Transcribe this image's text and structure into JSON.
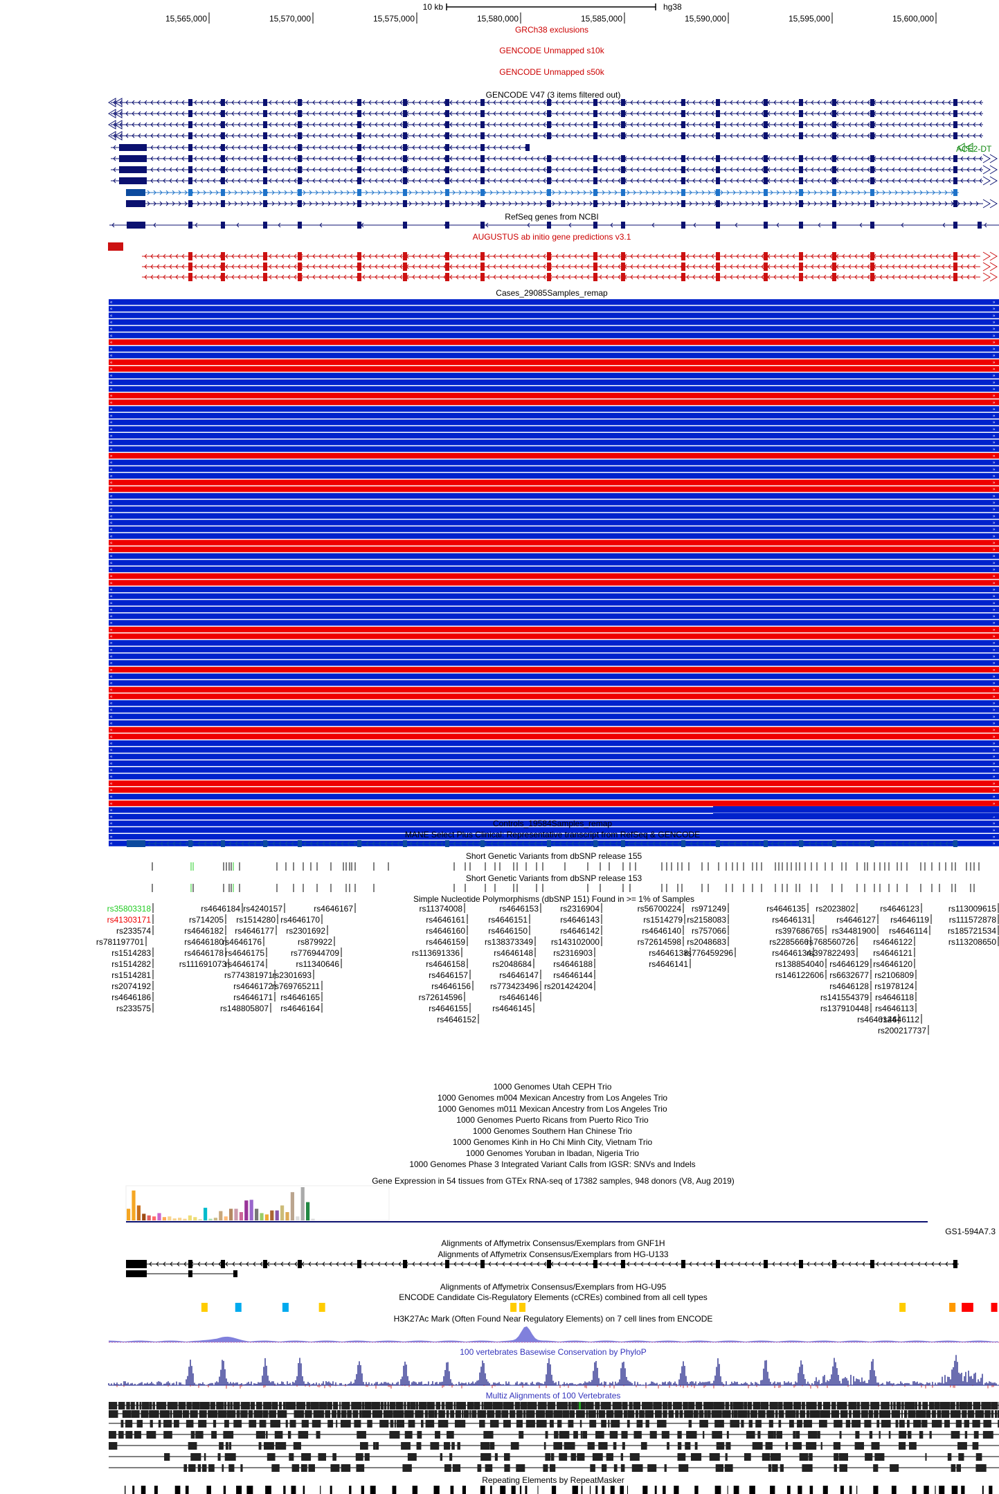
{
  "ruler": {
    "scale_label": "10 kb",
    "assembly": "hg38",
    "positions": [
      "15,565,000",
      "15,570,000",
      "15,575,000",
      "15,580,000",
      "15,585,000",
      "15,590,000",
      "15,595,000",
      "15,600,000"
    ]
  },
  "tracks": {
    "grch38_exclusions": "GRCh38 exclusions",
    "gencode_unmapped_s10k": "GENCODE Unmapped s10k",
    "gencode_unmapped_s50k": "GENCODE Unmapped s50k",
    "gencode": "GENCODE V47 (3 items filtered out)",
    "gencode_item_ace2": "ACE2-DT",
    "refseq": "RefSeq genes from NCBI",
    "augustus": "AUGUSTUS ab initio gene predictions v3.1",
    "cases": "Cases_29085Samples_remap",
    "controls": "Controls_19584Samples_remap",
    "mane": "MANE Select Plus Clinical: Representative transcript from RefSeq & GENCODE",
    "dbsnp155": "Short Genetic Variants from dbSNP release 155",
    "dbsnp153": "Short Genetic Variants from dbSNP release 153",
    "common_snps": "Simple Nucleotide Polymorphisms (dbSNP 151) Found in >= 1% of Samples",
    "g1000": [
      "1000 Genomes Utah CEPH Trio",
      "1000 Genomes m004 Mexican Ancestry from Los Angeles Trio",
      "1000 Genomes m011 Mexican Ancestry from Los Angeles Trio",
      "1000 Genomes Puerto Ricans from Puerto Rico Trio",
      "1000 Genomes Southern Han Chinese Trio",
      "1000 Genomes Kinh in Ho Chi Minh City, Vietnam Trio",
      "1000 Genomes Yoruban in Ibadan, Nigeria Trio",
      "1000 Genomes Phase 3 Integrated Variant Calls from IGSR: SNVs and Indels"
    ],
    "gtex": "Gene Expression in 54 tissues from GTEx RNA-seq of 17382 samples, 948 donors (V8, Aug 2019)",
    "gtex_gene": "GS1-594A7.3",
    "affy_gnf1h": "Alignments of Affymetrix Consensus/Exemplars from GNF1H",
    "affy_hgu133": "Alignments of Affymetrix Consensus/Exemplars from HG-U133",
    "affy_hgu95": "Alignments of Affymetrix Consensus/Exemplars from HG-U95",
    "encode_ccres": "ENCODE Candidate Cis-Regulatory Elements (cCREs) combined from all cell types",
    "h3k27ac": "H3K27Ac Mark (Often Found Near Regulatory Elements) on 7 cell lines from ENCODE",
    "phylop": "100 vertebrates Basewise Conservation by PhyloP",
    "multiz": "Multiz Alignments of 100 Vertebrates",
    "repeatmasker": "Repeating Elements by RepeatMasker"
  },
  "snp_columns": [
    [
      "rs35803318",
      "rs41303171",
      "rs233574",
      "rs781197701",
      "rs1514283",
      "rs1514282",
      "rs1514281",
      "rs2074192",
      "rs4646186",
      "rs233575"
    ],
    [
      "rs4646184",
      "rs714205",
      "rs4646182",
      "rs4646180",
      "rs4646178",
      "rs111691073"
    ],
    [
      "rs4240157",
      "rs1514280",
      "rs4646177",
      "rs4646176",
      "rs4646175",
      "rs4646174",
      "rs774381971",
      "rs4646172",
      "rs4646171",
      "rs148805807"
    ],
    [
      "rs4646167",
      "rs4646170",
      "rs2301692",
      "rs879922",
      "rs776944709",
      "rs11340646",
      "rs2301693",
      "rs769765211",
      "rs4646165",
      "rs4646164"
    ],
    [
      "rs11374008",
      "rs4646161",
      "rs4646160",
      "rs4646159",
      "rs113691336",
      "rs4646158",
      "rs4646157",
      "rs4646156",
      "rs72614596",
      "rs4646155",
      "rs4646152"
    ],
    [
      "rs4646153",
      "rs4646151",
      "rs4646150",
      "rs138373349",
      "rs4646148",
      "rs2048684",
      "rs4646147",
      "rs773423496",
      "rs4646146",
      "rs4646145"
    ],
    [
      "rs2316904",
      "rs4646143",
      "rs4646142",
      "rs143102000",
      "rs2316903",
      "rs4646188",
      "rs4646144",
      "rs201424204"
    ],
    [
      "rs56700224",
      "rs1514279",
      "rs4646140",
      "rs72614598",
      "rs4646138",
      "rs4646141"
    ],
    [
      "rs971249",
      "rs2158083",
      "rs757066",
      "rs2048683",
      "rs776459296"
    ],
    [
      "rs4646135",
      "rs4646131",
      "rs397686765",
      "rs2285666",
      "rs4646134",
      "rs138854040",
      "rs146122606"
    ],
    [
      "rs2023802",
      "rs4646127",
      "rs34481900",
      "rs768560726",
      "rs397822493",
      "rs4646129",
      "rs6632677",
      "rs4646128",
      "rs141554379",
      "rs137910448",
      "rs4646124"
    ],
    [
      "rs4646123",
      "rs4646119",
      "rs4646114",
      "rs4646122",
      "rs4646121",
      "rs4646120",
      "rs2106809",
      "rs1978124",
      "rs4646118",
      "rs4646113",
      "rs4646112",
      "rs200217737"
    ],
    [
      "rs113009615",
      "rs111572878",
      "rs185721534",
      "rs113208650"
    ]
  ],
  "snp_colors": {
    "rs35803318": "#22cc22",
    "rs41303171": "#ee0000"
  },
  "colors": {
    "gene_navy": "#0b1170",
    "mane_blue": "#0c4a9e",
    "augustus_red": "#cc1111",
    "case_red": "#ee0000",
    "case_blue": "#0022cc",
    "title_red": "#cc0000",
    "ace2_green": "#118811",
    "phylop_blue": "#2b2f8f",
    "h3k27ac": "#6a6ad6"
  },
  "gtex_bars": [
    {
      "v": 0.35,
      "c": "#f5a623"
    },
    {
      "v": 0.9,
      "c": "#f5a623"
    },
    {
      "v": 0.45,
      "c": "#c86f1b"
    },
    {
      "v": 0.2,
      "c": "#9e4a14"
    },
    {
      "v": 0.15,
      "c": "#e06060"
    },
    {
      "v": 0.12,
      "c": "#ff6a6a"
    },
    {
      "v": 0.22,
      "c": "#cc66cc"
    },
    {
      "v": 0.1,
      "c": "#ffaa55"
    },
    {
      "v": 0.12,
      "c": "#f8d48e"
    },
    {
      "v": 0.06,
      "c": "#f8d48e"
    },
    {
      "v": 0.08,
      "c": "#f8d48e"
    },
    {
      "v": 0.05,
      "c": "#f8d48e"
    },
    {
      "v": 0.15,
      "c": "#eedd77"
    },
    {
      "v": 0.1,
      "c": "#eedd77"
    },
    {
      "v": 0.04,
      "c": "#ddddaa"
    },
    {
      "v": 0.38,
      "c": "#00bbcc"
    },
    {
      "v": 0.05,
      "c": "#aaddaa"
    },
    {
      "v": 0.08,
      "c": "#ccbb88"
    },
    {
      "v": 0.28,
      "c": "#c9a77c"
    },
    {
      "v": 0.12,
      "c": "#ffbb77"
    },
    {
      "v": 0.35,
      "c": "#b58863"
    },
    {
      "v": 0.35,
      "c": "#cc99aa"
    },
    {
      "v": 0.25,
      "c": "#cc6699"
    },
    {
      "v": 0.6,
      "c": "#993399"
    },
    {
      "v": 0.62,
      "c": "#9966cc"
    },
    {
      "v": 0.35,
      "c": "#777777"
    },
    {
      "v": 0.22,
      "c": "#99cc66"
    },
    {
      "v": 0.18,
      "c": "#eeaa33"
    },
    {
      "v": 0.3,
      "c": "#aa6633"
    },
    {
      "v": 0.3,
      "c": "#8855aa"
    },
    {
      "v": 0.45,
      "c": "#ccbb77"
    },
    {
      "v": 0.25,
      "c": "#ddaa55"
    },
    {
      "v": 0.85,
      "c": "#bba58f"
    },
    {
      "v": 0.12,
      "c": "#dddddd"
    },
    {
      "v": 1.0,
      "c": "#aaaaaa"
    },
    {
      "v": 0.55,
      "c": "#228844"
    },
    {
      "v": 0.05,
      "c": "#dddddd"
    }
  ],
  "ccre_marks": [
    {
      "x": 0.108,
      "c": "#ffcc00"
    },
    {
      "x": 0.146,
      "c": "#00aaee"
    },
    {
      "x": 0.199,
      "c": "#00aaee"
    },
    {
      "x": 0.24,
      "c": "#ffcc00"
    },
    {
      "x": 0.455,
      "c": "#ffcc00"
    },
    {
      "x": 0.465,
      "c": "#ffcc00"
    },
    {
      "x": 0.892,
      "c": "#ffcc00"
    },
    {
      "x": 0.948,
      "c": "#ff9900"
    },
    {
      "x": 0.962,
      "c": "#ff0000"
    },
    {
      "x": 0.968,
      "c": "#ff0000"
    },
    {
      "x": 0.995,
      "c": "#ff0000"
    }
  ]
}
